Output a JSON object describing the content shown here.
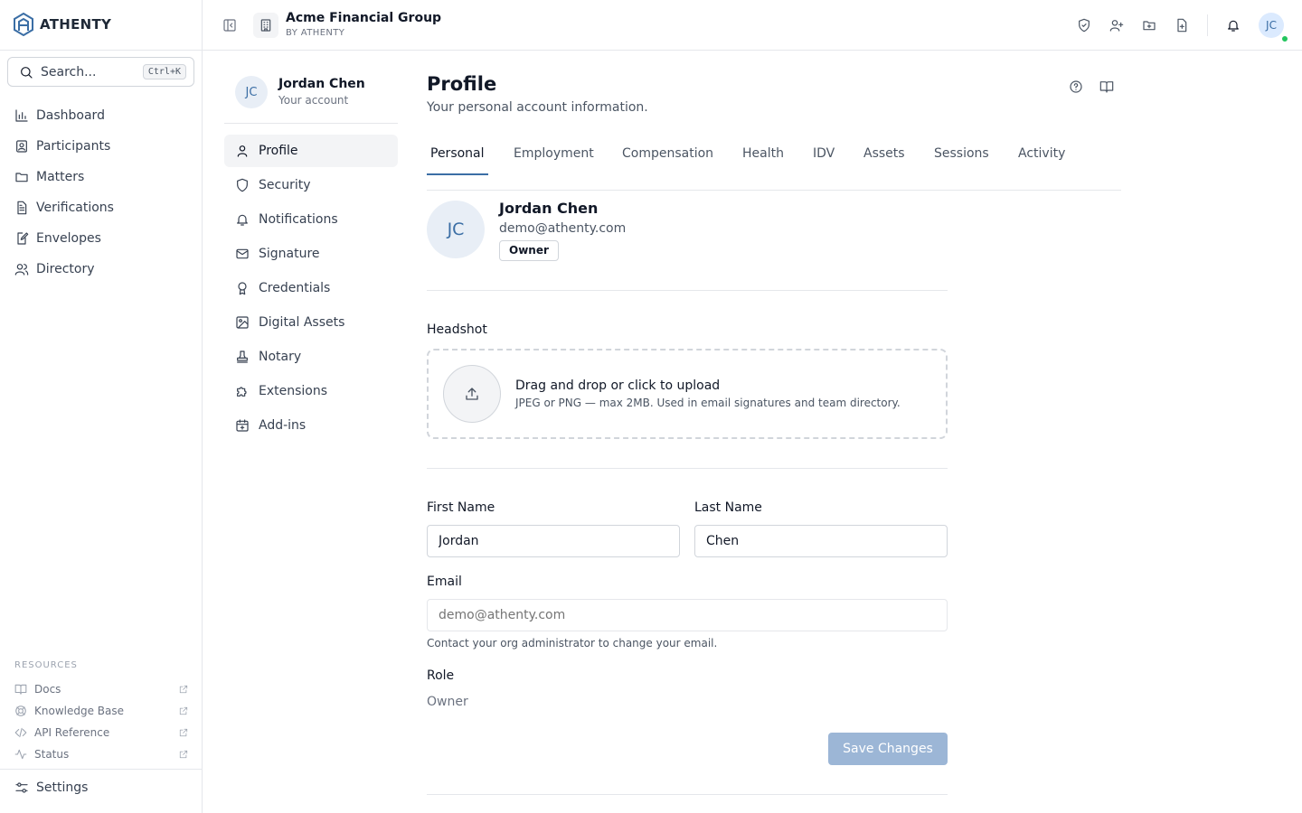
{
  "brand": {
    "name": "ATHENTY"
  },
  "search": {
    "placeholder": "Search...",
    "shortcut": "Ctrl+K"
  },
  "nav": {
    "items": [
      {
        "label": "Dashboard",
        "icon": "bar-chart-icon"
      },
      {
        "label": "Participants",
        "icon": "contact-card-icon"
      },
      {
        "label": "Matters",
        "icon": "folder-icon"
      },
      {
        "label": "Verifications",
        "icon": "file-check-icon"
      },
      {
        "label": "Envelopes",
        "icon": "file-pen-icon"
      },
      {
        "label": "Directory",
        "icon": "users-icon"
      }
    ]
  },
  "resources": {
    "label": "RESOURCES",
    "items": [
      {
        "label": "Docs",
        "icon": "book-icon"
      },
      {
        "label": "Knowledge Base",
        "icon": "lifebuoy-icon"
      },
      {
        "label": "API Reference",
        "icon": "code-icon"
      },
      {
        "label": "Status",
        "icon": "activity-icon"
      }
    ]
  },
  "settings_label": "Settings",
  "org": {
    "name": "Acme Financial Group",
    "sub": "BY ATHENTY"
  },
  "user": {
    "initials": "JC",
    "name": "Jordan Chen",
    "account_label": "Your account",
    "email": "demo@athenty.com",
    "role": "Owner"
  },
  "settings_nav": {
    "items": [
      {
        "label": "Profile",
        "icon": "user-icon",
        "active": true
      },
      {
        "label": "Security",
        "icon": "shield-icon"
      },
      {
        "label": "Notifications",
        "icon": "bell-icon"
      },
      {
        "label": "Signature",
        "icon": "mail-icon"
      },
      {
        "label": "Credentials",
        "icon": "award-icon"
      },
      {
        "label": "Digital Assets",
        "icon": "image-icon"
      },
      {
        "label": "Notary",
        "icon": "stamp-icon"
      },
      {
        "label": "Extensions",
        "icon": "puzzle-icon"
      },
      {
        "label": "Add-ins",
        "icon": "calendar-plus-icon"
      }
    ]
  },
  "page": {
    "title": "Profile",
    "subtitle": "Your personal account information."
  },
  "tabs": [
    "Personal",
    "Employment",
    "Compensation",
    "Health",
    "IDV",
    "Assets",
    "Sessions",
    "Activity"
  ],
  "headshot": {
    "label": "Headshot",
    "upload_title": "Drag and drop or click to upload",
    "upload_hint": "JPEG or PNG — max 2MB. Used in email signatures and team directory."
  },
  "form": {
    "first_name_label": "First Name",
    "first_name": "Jordan",
    "last_name_label": "Last Name",
    "last_name": "Chen",
    "email_label": "Email",
    "email_placeholder": "demo@athenty.com",
    "email_help": "Contact your org administrator to change your email.",
    "role_label": "Role",
    "role_value": "Owner",
    "save_label": "Save Changes"
  },
  "colors": {
    "accent": "#3b6ea5",
    "save_disabled": "#9cb6d6",
    "online": "#22c55e"
  }
}
